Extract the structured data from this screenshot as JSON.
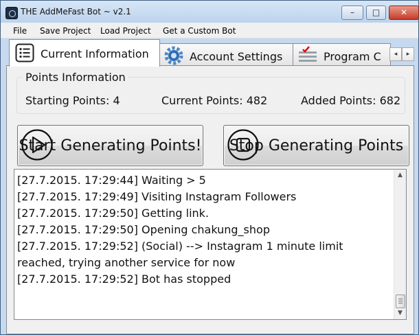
{
  "window": {
    "title": "THE AddMeFast Bot ~ v2.1",
    "controls": {
      "minimize": "–",
      "maximize": "□",
      "close": "✕"
    }
  },
  "menu": [
    "File",
    "Save Project",
    "Load Project",
    "Get a Custom Bot"
  ],
  "tabs": [
    {
      "label": "Current Information",
      "icon": "list-icon",
      "active": true
    },
    {
      "label": "Account Settings",
      "icon": "gear-icon",
      "active": false
    },
    {
      "label": "Program C",
      "icon": "checklist-icon",
      "active": false
    }
  ],
  "tab_scroll": {
    "left": "◂",
    "right": "▸"
  },
  "points_info": {
    "title": "Points Information",
    "starting": "Starting Points: 4",
    "current": "Current Points: 482",
    "added": "Added Points: 682"
  },
  "buttons": {
    "start": {
      "label": "Start Generating Points!",
      "icon": "play-icon"
    },
    "stop": {
      "label": "Stop Generating Points",
      "icon": "stop-icon"
    }
  },
  "log": [
    "[27.7.2015. 17:29:44] Waiting > 5",
    "[27.7.2015. 17:29:49] Visiting Instagram Followers",
    "[27.7.2015. 17:29:50] Getting link.",
    "[27.7.2015. 17:29:50] Opening chakung_shop",
    "[27.7.2015. 17:29:52] (Social) --> Instagram 1 minute limit reached, trying another service for now",
    "[27.7.2015. 17:29:52] Bot has stopped"
  ],
  "scrollbar": {
    "up": "▲",
    "down": "▼"
  },
  "colors": {
    "window_frame": "#c6d9ee",
    "close_button": "#c43c2a",
    "panel": "#f0f0f0"
  }
}
